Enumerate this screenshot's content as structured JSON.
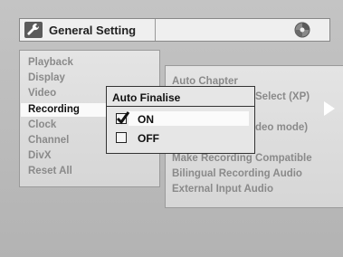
{
  "header": {
    "title": "General Setting",
    "icon": "wrench-icon",
    "right_icon": "disc-icon"
  },
  "menu": {
    "items": [
      {
        "label": "Playback"
      },
      {
        "label": "Display"
      },
      {
        "label": "Video"
      },
      {
        "label": "Recording",
        "selected": true
      },
      {
        "label": "Clock"
      },
      {
        "label": "Channel"
      },
      {
        "label": "DivX"
      },
      {
        "label": "Reset All"
      }
    ]
  },
  "submenu": {
    "items": [
      {
        "label": "Auto Chapter"
      },
      {
        "label": "Select (XP)"
      },
      {
        "label": "deo mode)"
      },
      {
        "label": "Make Recording Compatible"
      },
      {
        "label": "Bilingual Recording Audio"
      },
      {
        "label": "External Input Audio"
      }
    ]
  },
  "popup": {
    "title": "Auto Finalise",
    "options": [
      {
        "label": "ON",
        "checked": true
      },
      {
        "label": "OFF",
        "checked": false
      }
    ]
  },
  "colors": {
    "background": "#b7b7b7",
    "panel": "#dedede",
    "highlight": "#fafafa",
    "text_dim": "#8a8a8a",
    "text_active": "#111111"
  }
}
